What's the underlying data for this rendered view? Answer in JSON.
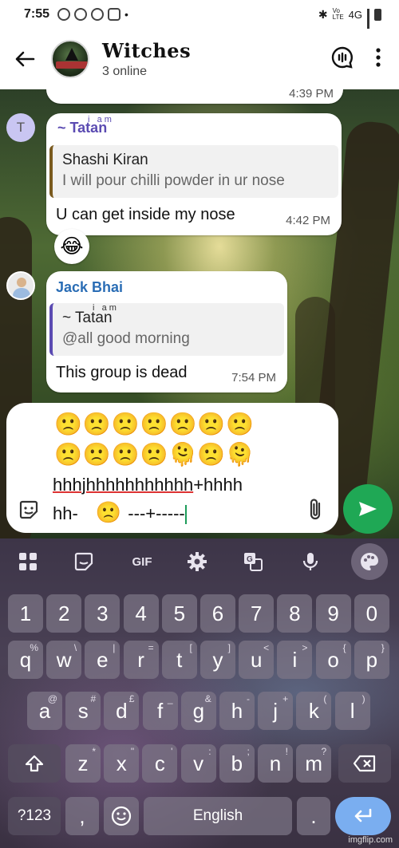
{
  "status_bar": {
    "time": "7:55",
    "network": "4G",
    "volte": "Vo LTE"
  },
  "header": {
    "group_name": "Witches",
    "subtitle": "3 online"
  },
  "chat": {
    "prev_time": "4:39 PM",
    "messages": [
      {
        "sender": "~ Tatan",
        "sender_superscript": "i   a m",
        "sender_color": "#5b4bb2",
        "avatar_letter": "T",
        "quote_name": "Shashi Kiran",
        "quote_text": "I will pour chilli powder in ur nose",
        "text": "U can get inside my nose",
        "time": "4:42 PM",
        "reaction": "😂"
      },
      {
        "sender": "Jack Bhai",
        "sender_color": "#2a6db5",
        "quote_name": "~ Tatan",
        "quote_name_superscript": "i   a m",
        "quote_text": "@all good morning",
        "text": "This group is dead",
        "time": "7:54 PM"
      }
    ]
  },
  "composer": {
    "emoji_row_1": "🙁🙁🙁🙁🙁🙁🙁",
    "emoji_row_2": "🙁🙁🙁🙁🫠🙁🫠",
    "text_line_1_misspelled": "hhhjhhhhhhhhhhh",
    "text_line_1_rest": "+hhhh",
    "text_line_2_start": "hh-",
    "text_line_2_emoji": "🙁",
    "text_line_2_end": "---+-----"
  },
  "keyboard": {
    "toolbar": [
      "apps-grid",
      "sticker",
      "GIF",
      "settings",
      "translate",
      "mic",
      "theme-palette"
    ],
    "gif_label": "GIF",
    "row_numbers": [
      "1",
      "2",
      "3",
      "4",
      "5",
      "6",
      "7",
      "8",
      "9",
      "0"
    ],
    "row_1": [
      {
        "k": "q",
        "h": "%"
      },
      {
        "k": "w",
        "h": "\\"
      },
      {
        "k": "e",
        "h": "|"
      },
      {
        "k": "r",
        "h": "="
      },
      {
        "k": "t",
        "h": "["
      },
      {
        "k": "y",
        "h": "]"
      },
      {
        "k": "u",
        "h": "<"
      },
      {
        "k": "i",
        "h": ">"
      },
      {
        "k": "o",
        "h": "{"
      },
      {
        "k": "p",
        "h": "}"
      }
    ],
    "row_2": [
      {
        "k": "a",
        "h": "@"
      },
      {
        "k": "s",
        "h": "#"
      },
      {
        "k": "d",
        "h": "£"
      },
      {
        "k": "f",
        "h": "_"
      },
      {
        "k": "g",
        "h": "&"
      },
      {
        "k": "h",
        "h": "-"
      },
      {
        "k": "j",
        "h": "+"
      },
      {
        "k": "k",
        "h": "("
      },
      {
        "k": "l",
        "h": ")"
      }
    ],
    "row_3": [
      {
        "k": "z",
        "h": "*"
      },
      {
        "k": "x",
        "h": "\""
      },
      {
        "k": "c",
        "h": "'"
      },
      {
        "k": "v",
        "h": ":"
      },
      {
        "k": "b",
        "h": ";"
      },
      {
        "k": "n",
        "h": "!"
      },
      {
        "k": "m",
        "h": "?"
      }
    ],
    "symbols_label": "?123",
    "comma": ",",
    "space_label": "English",
    "period": "."
  },
  "watermark": "imgflip.com"
}
